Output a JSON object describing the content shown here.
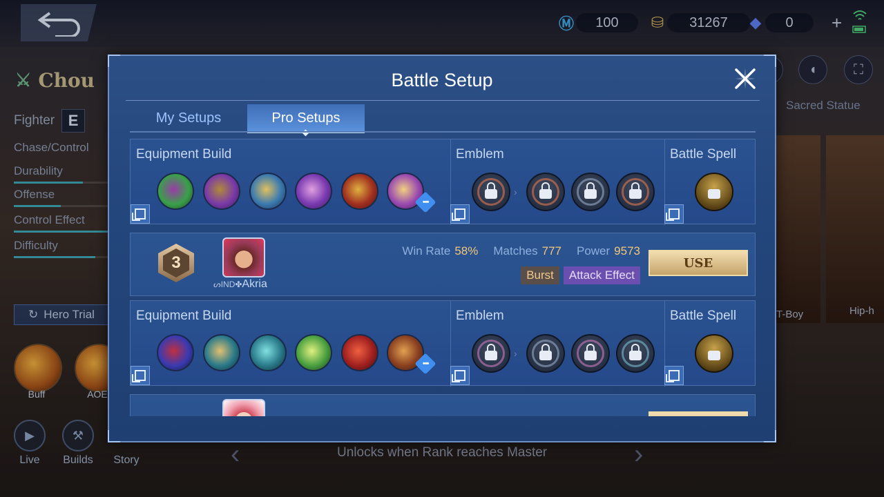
{
  "header": {
    "currencies": [
      {
        "icon": "m-ticket-icon",
        "value": "100"
      },
      {
        "icon": "gold-coin-icon",
        "value": "31267"
      },
      {
        "icon": "diamond-icon",
        "value": "0"
      }
    ],
    "plus": "+"
  },
  "hero": {
    "name": "Chou",
    "role": "Fighter",
    "role_glyph": "E",
    "stats": [
      {
        "label": "Chase/Control"
      },
      {
        "label": "Durability"
      },
      {
        "label": "Offense"
      },
      {
        "label": "Control Effect"
      },
      {
        "label": "Difficulty"
      }
    ],
    "trial_label": "Hero Trial",
    "skills": [
      {
        "label": "Buff"
      },
      {
        "label": "AOE"
      }
    ],
    "nav": [
      {
        "label": "Live"
      },
      {
        "label": "Builds"
      },
      {
        "label": "Story"
      }
    ]
  },
  "right": {
    "sacred": "Sacred Statue",
    "card1": "T-Boy",
    "card2": "Hip-h"
  },
  "unlock_text": "Unlocks when Rank reaches Master",
  "modal": {
    "title": "Battle Setup",
    "tabs": [
      {
        "label": "My Setups",
        "active": false
      },
      {
        "label": "Pro Setups",
        "active": true
      }
    ],
    "sections": {
      "equipment": "Equipment Build",
      "emblem": "Emblem",
      "spell": "Battle Spell"
    },
    "builds": [
      {
        "items": [
          "boots-item-icon",
          "helmet-item-icon",
          "blade-item-icon",
          "shield-item-icon",
          "axe-item-icon",
          "wings-item-icon"
        ],
        "emblems": [
          "basic-emblem-icon",
          "talent-heart-icon",
          "talent-hammer-icon",
          "talent-core-icon"
        ]
      },
      {
        "player": {
          "rank": "3",
          "name": "Akria",
          "prefix": "ᔕIND✤"
        },
        "stats": [
          {
            "label": "Win Rate",
            "value": "58%"
          },
          {
            "label": "Matches",
            "value": "777"
          },
          {
            "label": "Power",
            "value": "9573"
          }
        ],
        "tags": [
          {
            "label": "Burst"
          },
          {
            "label": "Attack Effect"
          }
        ],
        "use": "USE",
        "items": [
          "dagger-item-icon",
          "gauntlet-item-icon",
          "spear-item-icon",
          "sword-item-icon",
          "crimson-blade-icon",
          "cannon-item-icon"
        ],
        "emblems": [
          "assassin-emblem-icon",
          "talent-blade-icon",
          "talent-target-icon",
          "talent-swirl-icon"
        ]
      }
    ]
  },
  "colors": {
    "modal_bg": "#2c4f86",
    "accent_gold": "#f2c77a",
    "tab_active": "#5b92dc"
  }
}
